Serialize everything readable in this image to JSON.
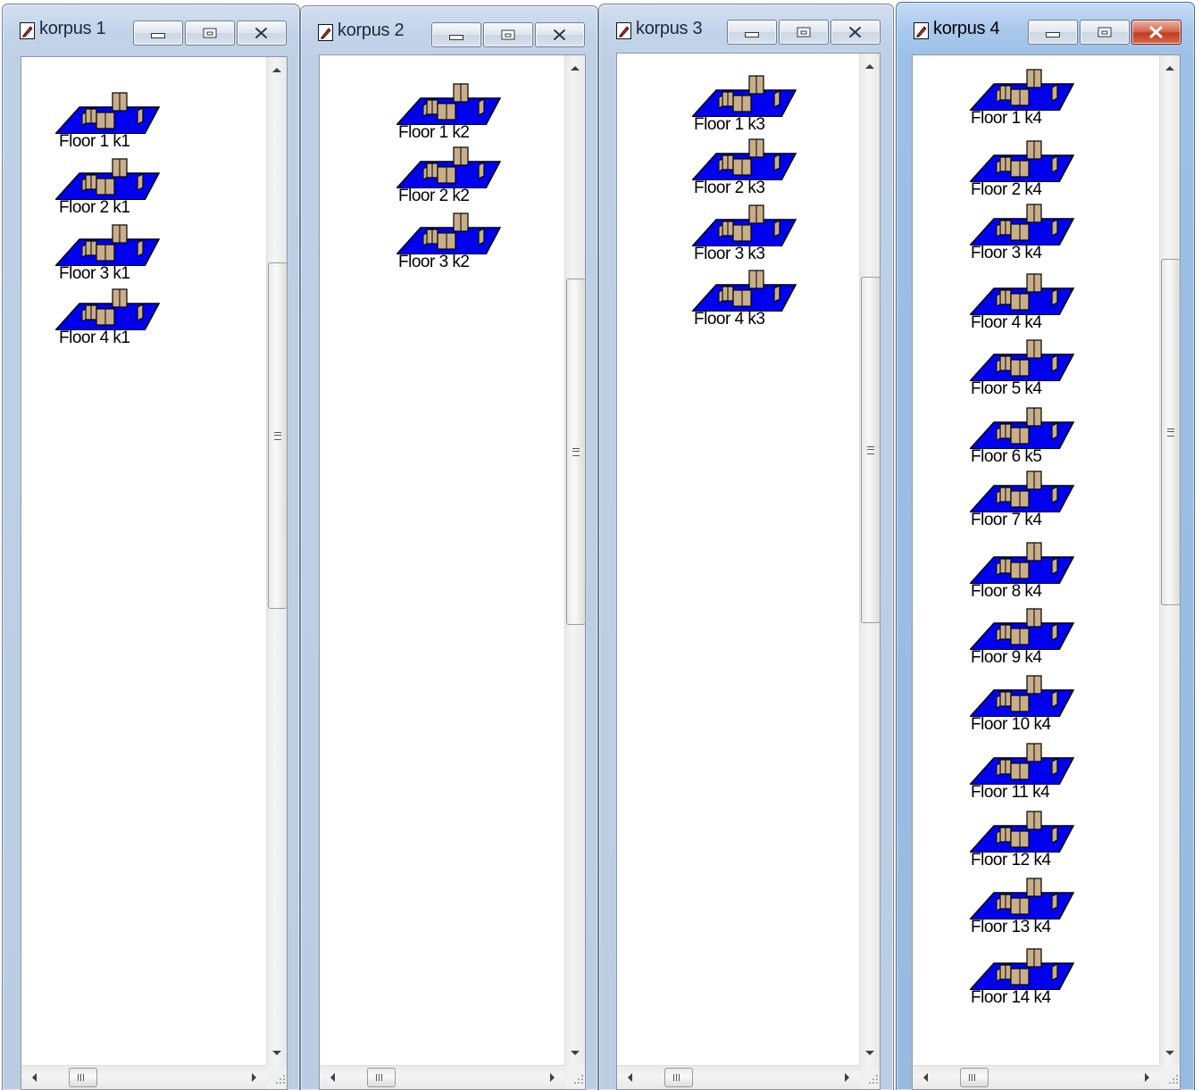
{
  "colors": {
    "floor_plate": "#0000ee",
    "box": "#c9ae8a",
    "close_active": "#c23b22"
  },
  "icons": {
    "window_icon": "document-pencil-icon",
    "floor_icon": "floor-plan-icon"
  },
  "windows": [
    {
      "title": "korpus 1",
      "active": false,
      "floors": [
        "Floor 1 k1",
        "Floor 2 k1",
        "Floor 3 k1",
        "Floor 4 k1"
      ]
    },
    {
      "title": "korpus 2",
      "active": false,
      "floors": [
        "Floor 1 k2",
        "Floor 2 k2",
        "Floor 3 k2"
      ]
    },
    {
      "title": "korpus 3",
      "active": false,
      "floors": [
        "Floor 1 k3",
        "Floor 2 k3",
        "Floor 3 k3",
        "Floor 4 k3"
      ]
    },
    {
      "title": "korpus 4",
      "active": true,
      "floors": [
        "Floor 1 k4",
        "Floor 2 k4",
        "Floor 3 k4",
        "Floor 4 k4",
        "Floor 5 k4",
        "Floor 6 k5",
        "Floor 7 k4",
        "Floor 8 k4",
        "Floor 9 k4",
        "Floor 10 k4",
        "Floor 11 k4",
        "Floor 12 k4",
        "Floor 13 k4",
        "Floor 14 k4"
      ]
    }
  ]
}
